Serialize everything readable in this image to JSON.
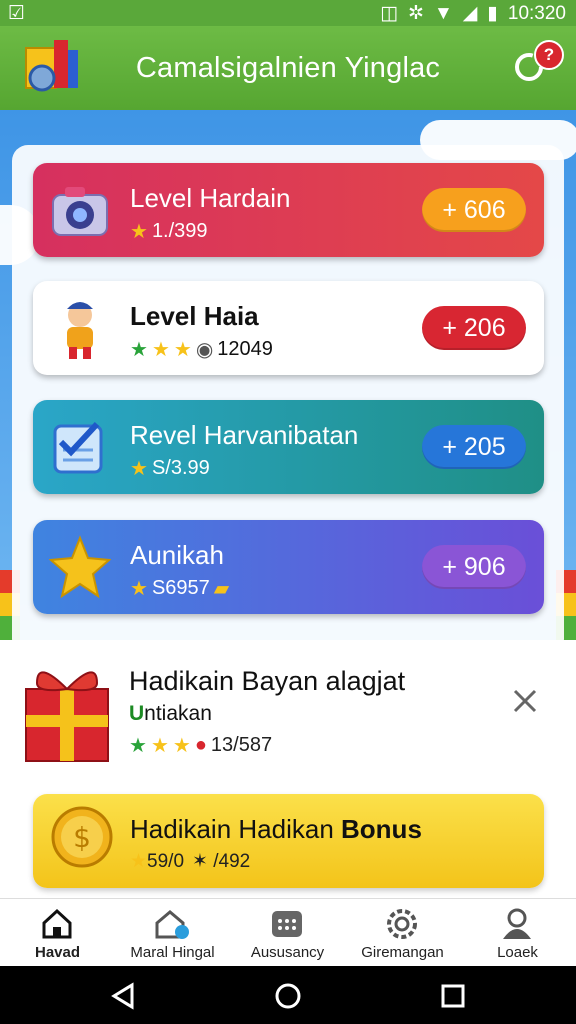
{
  "status_bar": {
    "time": "10:320",
    "icons": [
      "check-box-icon",
      "vibrate-icon",
      "gear-cluster-icon",
      "wifi-icon",
      "signal-icon",
      "battery-icon"
    ]
  },
  "app_bar": {
    "title": "Camalsigalnien Yinglac",
    "notification_count": "?"
  },
  "cards": [
    {
      "title": "Level Hardain",
      "sub": "1./399",
      "rating_icons": [
        "star"
      ],
      "action": "+ 606",
      "color": "#f7a01d"
    },
    {
      "title": "Level Haia",
      "sub": "12049",
      "rating_icons": [
        "green-star",
        "star",
        "star",
        "coin"
      ],
      "action": "+ 206",
      "color": "#d82632"
    },
    {
      "title": "Revel Harvanibatan",
      "sub": "S/3.99",
      "rating_icons": [
        "star"
      ],
      "action": "+ 205",
      "color": "#2676d9"
    },
    {
      "title": "Aunikah",
      "sub": "S6957",
      "rating_icons": [
        "star"
      ],
      "action": "+ 906",
      "color": "#8a55d6"
    }
  ],
  "promo": {
    "title": "Hadikain Bayan alagjat",
    "tag_initial": "U",
    "tag_rest": "ntiakan",
    "sub": "13/587"
  },
  "bonus": {
    "title_normal": "Hadikain Hadikan ",
    "title_bold": "Bonus",
    "sub_left": "59/0",
    "sub_right": "✶ /492"
  },
  "bottom_nav": [
    {
      "label": "Havad",
      "icon": "home-icon",
      "active": true
    },
    {
      "label": "Maral Hingal",
      "icon": "house-c-icon",
      "active": false
    },
    {
      "label": "Aususancy",
      "icon": "grid-icon",
      "active": false
    },
    {
      "label": "Giremangan",
      "icon": "settings-icon",
      "active": false
    },
    {
      "label": "Loaek",
      "icon": "profile-icon",
      "active": false
    }
  ]
}
